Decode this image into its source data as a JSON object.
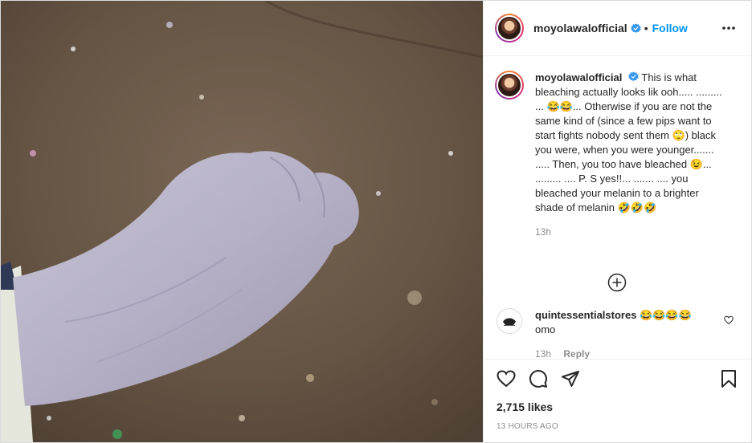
{
  "post": {
    "username": "moyolawalofficial",
    "follow_label": "Follow",
    "separator": "•",
    "caption": "This is what bleaching actually looks lik ooh..... ......... ... 😂😂... Otherwise if you are not the same kind of (since a few pips want to start fights nobody sent them 🙄) black you were, when you were younger....... ..... Then, you too have bleached 😉... ......... .... P. S yes!!... ....... .... you bleached your melanin to a brighter shade of melanin 🤣🤣🤣",
    "caption_time": "13h"
  },
  "comments": [
    {
      "username": "quintessentialstores",
      "emoji": "😂😂😂😂",
      "text": "omo",
      "time": "13h",
      "reply_label": "Reply"
    }
  ],
  "actions": {
    "likes": "2,715 likes",
    "timestamp": "13 HOURS AGO"
  },
  "icons": [
    "verified-icon",
    "more-options-icon",
    "load-more-icon",
    "heart-icon",
    "comment-icon",
    "share-icon",
    "bookmark-icon"
  ],
  "colors": {
    "accent": "#0095f6",
    "text": "#262626",
    "muted": "#8e8e8e",
    "border": "#dbdbdb"
  }
}
